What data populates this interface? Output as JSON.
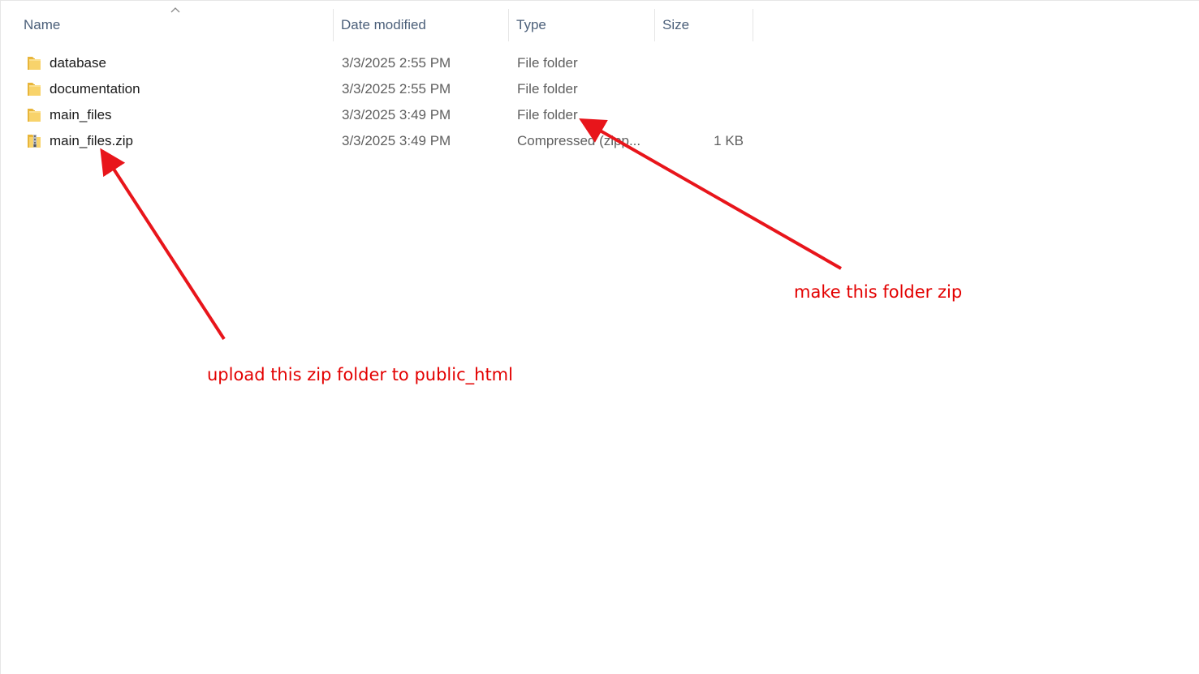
{
  "columns": {
    "name": "Name",
    "date_modified": "Date modified",
    "type": "Type",
    "size": "Size"
  },
  "files": [
    {
      "name": "database",
      "date": "3/3/2025 2:55 PM",
      "type": "File folder",
      "size": "",
      "icon": "folder-icon"
    },
    {
      "name": "documentation",
      "date": "3/3/2025 2:55 PM",
      "type": "File folder",
      "size": "",
      "icon": "folder-icon"
    },
    {
      "name": "main_files",
      "date": "3/3/2025 3:49 PM",
      "type": "File folder",
      "size": "",
      "icon": "folder-icon"
    },
    {
      "name": "main_files.zip",
      "date": "3/3/2025 3:49 PM",
      "type": "Compressed (zipp...",
      "size": "1 KB",
      "icon": "zip-folder-icon"
    }
  ],
  "annotations": {
    "zip_note": "make this folder zip",
    "upload_note": "upload this zip folder to public_html"
  },
  "colors": {
    "annotation": "#e30000",
    "folder": "#f5c542",
    "header_text": "#4c607a"
  }
}
